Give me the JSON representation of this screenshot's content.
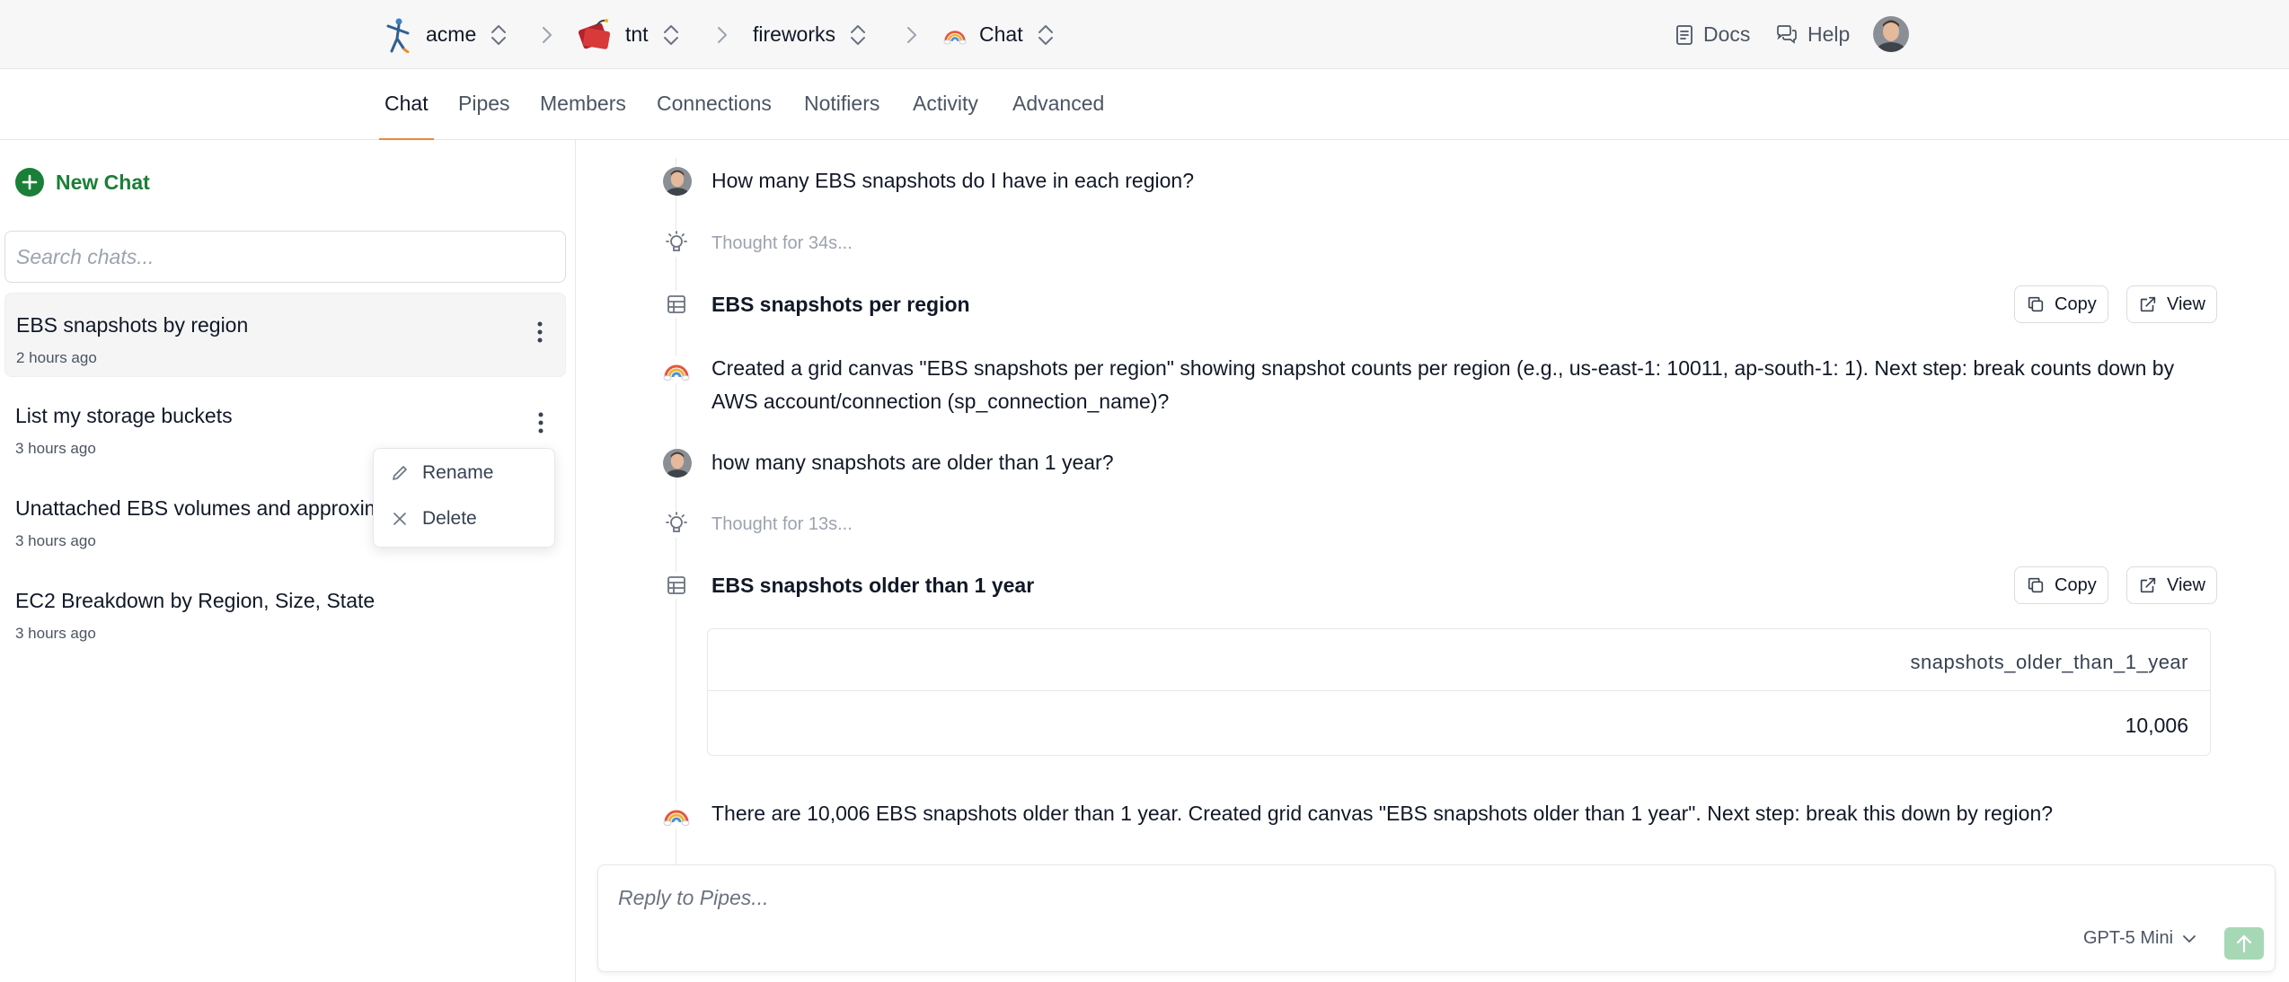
{
  "breadcrumbs": [
    {
      "label": "acme",
      "icon": "figure-logo-icon"
    },
    {
      "label": "tnt",
      "icon": "tnt-logo-icon"
    },
    {
      "label": "fireworks",
      "icon": ""
    },
    {
      "label": "Chat",
      "icon": "rainbow-icon"
    }
  ],
  "header": {
    "docs_label": "Docs",
    "help_label": "Help"
  },
  "tabs": [
    "Chat",
    "Pipes",
    "Members",
    "Connections",
    "Notifiers",
    "Activity",
    "Advanced"
  ],
  "active_tab": "Chat",
  "sidebar": {
    "new_chat_label": "New Chat",
    "search_placeholder": "Search chats...",
    "chats": [
      {
        "title": "EBS snapshots by region",
        "time": "2 hours ago"
      },
      {
        "title": "List my storage buckets",
        "time": "3 hours ago"
      },
      {
        "title": "Unattached EBS volumes and approximate costs",
        "time": "3 hours ago"
      },
      {
        "title": "EC2 Breakdown by Region, Size, State",
        "time": "3 hours ago"
      }
    ],
    "context_menu": {
      "rename_label": "Rename",
      "delete_label": "Delete"
    }
  },
  "conversation": {
    "q1": "How many EBS snapshots do I have in each region?",
    "thought1": "Thought for 34s...",
    "canvas1": "EBS snapshots per region",
    "answer1_line1": "Created a grid canvas \"EBS snapshots per region\" showing snapshot counts per region (e.g., us-east-1: 10011, ap-south-1: 1). Next step: break counts down by",
    "answer1_line2": "AWS account/connection (sp_connection_name)?",
    "q2": "how many snapshots are older than 1 year?",
    "thought2": "Thought for 13s...",
    "canvas2": "EBS snapshots older than 1 year",
    "table": {
      "column": "snapshots_older_than_1_year",
      "value": "10,006"
    },
    "answer2": "There are 10,006 EBS snapshots older than 1 year. Created grid canvas \"EBS snapshots older than 1 year\". Next step: break this down by region?",
    "copy_label": "Copy",
    "view_label": "View"
  },
  "reply": {
    "placeholder": "Reply to Pipes...",
    "model_label": "GPT-5 Mini"
  },
  "colors": {
    "accent": "#1a7f37",
    "tab_underline": "#ea8a2e",
    "send_button": "#a7d8b6"
  }
}
